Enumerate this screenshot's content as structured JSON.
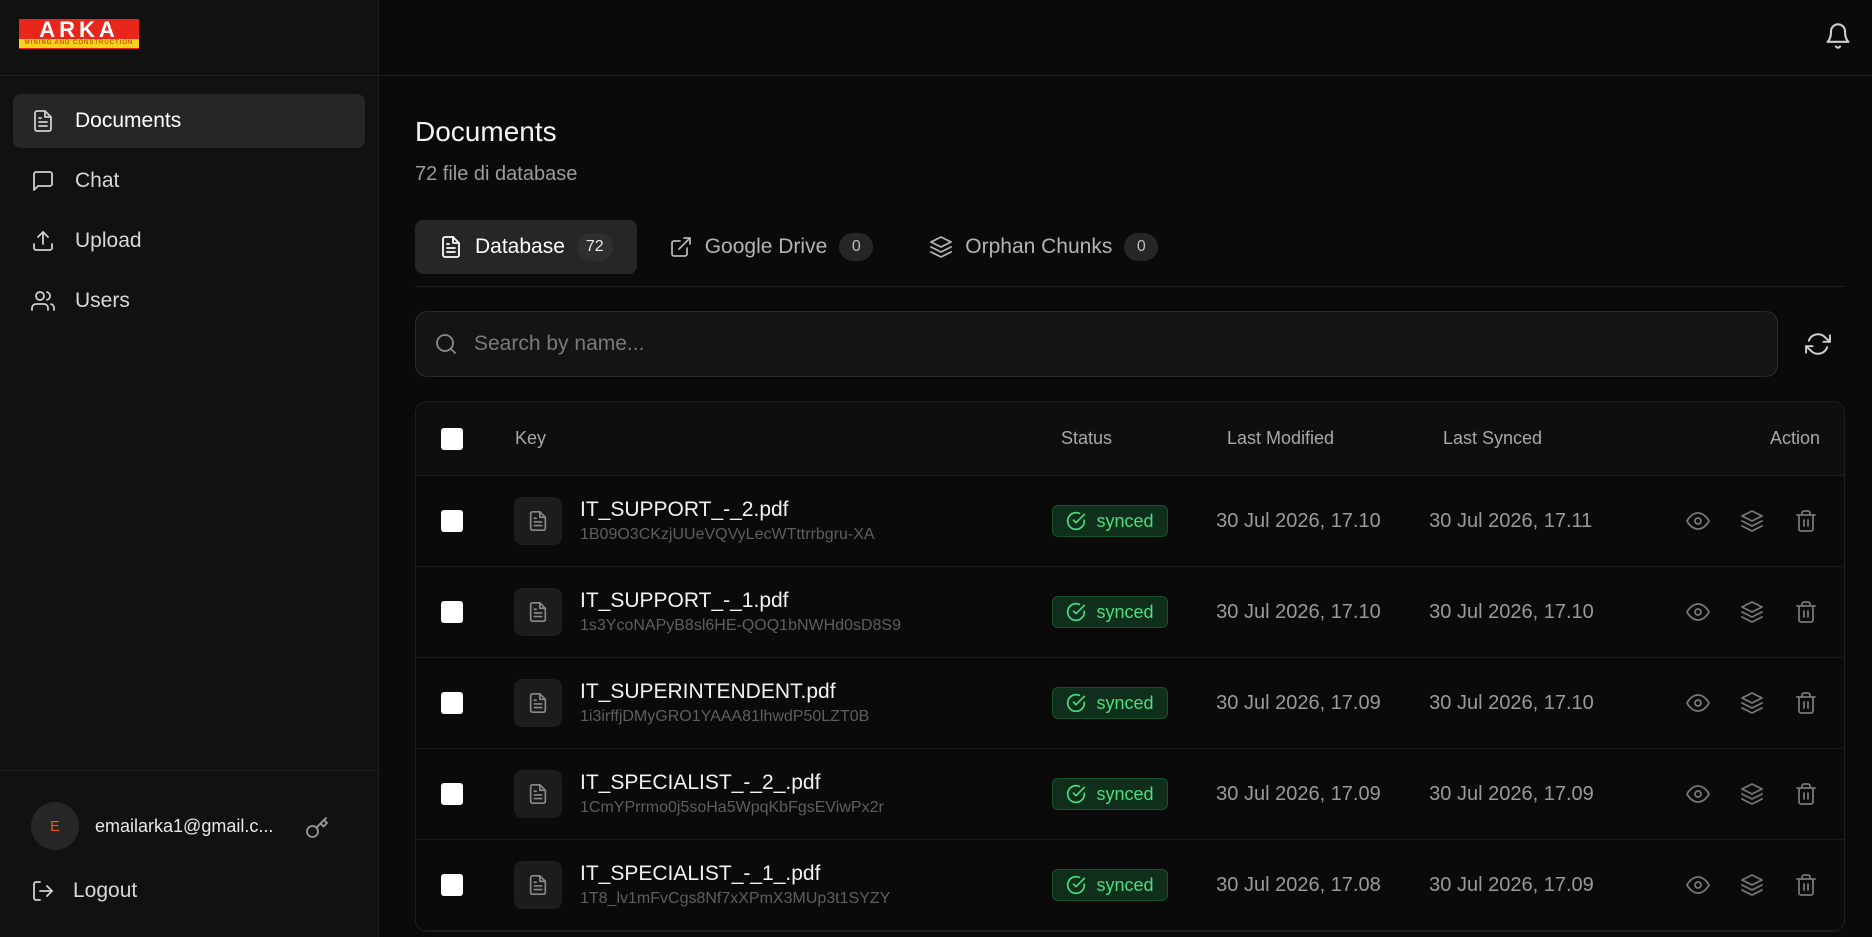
{
  "brand": {
    "logo_text": "ARKA",
    "logo_sub": "MINING AND CONSTRUCTION"
  },
  "sidebar": {
    "items": [
      {
        "label": "Documents",
        "icon": "file-text-icon",
        "active": true
      },
      {
        "label": "Chat",
        "icon": "message-square-icon",
        "active": false
      },
      {
        "label": "Upload",
        "icon": "upload-icon",
        "active": false
      },
      {
        "label": "Users",
        "icon": "users-icon",
        "active": false
      }
    ],
    "user": {
      "avatar_initial": "E",
      "email": "emailarka1@gmail.c..."
    },
    "logout_label": "Logout"
  },
  "header": {
    "icons": [
      "bell-icon"
    ]
  },
  "page": {
    "title": "Documents",
    "subtitle": "72 file di database"
  },
  "tabs": [
    {
      "label": "Database",
      "count": "72",
      "icon": "file-text-icon",
      "active": true
    },
    {
      "label": "Google Drive",
      "count": "0",
      "icon": "external-link-icon",
      "active": false
    },
    {
      "label": "Orphan Chunks",
      "count": "0",
      "icon": "layers-icon",
      "active": false
    }
  ],
  "search": {
    "placeholder": "Search by name...",
    "value": ""
  },
  "table": {
    "columns": {
      "key": "Key",
      "status": "Status",
      "last_modified": "Last Modified",
      "last_synced": "Last Synced",
      "action": "Action"
    },
    "rows": [
      {
        "name": "IT_SUPPORT_-_2.pdf",
        "id": "1B09O3CKzjUUeVQVyLecWTttrrbgru-XA",
        "status": "synced",
        "last_modified": "30 Jul 2026, 17.10",
        "last_synced": "30 Jul 2026, 17.11"
      },
      {
        "name": "IT_SUPPORT_-_1.pdf",
        "id": "1s3YcoNAPyB8sl6HE-QOQ1bNWHd0sD8S9",
        "status": "synced",
        "last_modified": "30 Jul 2026, 17.10",
        "last_synced": "30 Jul 2026, 17.10"
      },
      {
        "name": "IT_SUPERINTENDENT.pdf",
        "id": "1i3irffjDMyGRO1YAAA81lhwdP50LZT0B",
        "status": "synced",
        "last_modified": "30 Jul 2026, 17.09",
        "last_synced": "30 Jul 2026, 17.10"
      },
      {
        "name": "IT_SPECIALIST_-_2_.pdf",
        "id": "1CmYPrrmo0j5soHa5WpqKbFgsEViwPx2r",
        "status": "synced",
        "last_modified": "30 Jul 2026, 17.09",
        "last_synced": "30 Jul 2026, 17.09"
      },
      {
        "name": "IT_SPECIALIST_-_1_.pdf",
        "id": "1T8_lv1mFvCgs8Nf7xXPmX3MUp3t1SYZY",
        "status": "synced",
        "last_modified": "30 Jul 2026, 17.08",
        "last_synced": "30 Jul 2026, 17.09"
      }
    ],
    "row_actions": [
      "eye-icon",
      "layers-icon",
      "trash-icon"
    ]
  },
  "colors": {
    "background": "#0a0a0a",
    "sidebar": "#111111",
    "synced_green": "#4ade80",
    "logo_red": "#e8261c",
    "logo_yellow": "#f4d31a"
  }
}
